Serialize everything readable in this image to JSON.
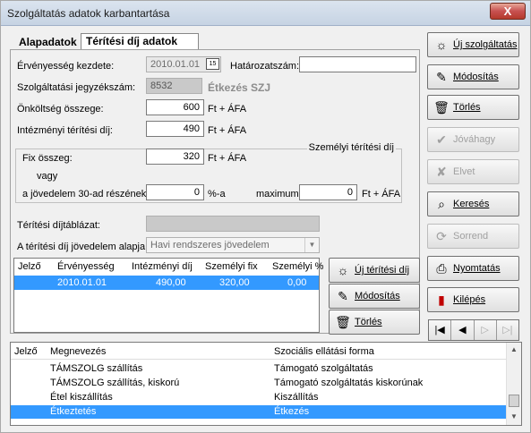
{
  "window": {
    "title": "Szolgáltatás adatok karbantartása",
    "close_label": "X"
  },
  "tabs": [
    "Alapadatok",
    "Térítési díj adatok"
  ],
  "form": {
    "ervenyesseg_label": "Érvényesség kezdete:",
    "ervenyesseg_value": "2010.01.01",
    "calendar_glyph": "15",
    "hatarozat_label": "Határozatszám:",
    "hatarozat_value": "",
    "jegyzekszam_label": "Szolgáltatási jegyzékszám:",
    "jegyzekszam_value": "8532",
    "jegyzekszam_name": "Étkezés SZJ",
    "onkoltseg_label": "Önköltség összege:",
    "onkoltseg_value": "600",
    "onkoltseg_unit": "Ft + ÁFA",
    "intezmenyi_label": "Intézményi térítési díj:",
    "intezmenyi_value": "490",
    "intezmenyi_unit": "Ft + ÁFA",
    "group_title": "Személyi térítési díj",
    "fix_label": "Fix összeg:",
    "fix_value": "320",
    "fix_unit": "Ft + ÁFA",
    "vagy_label": "vagy",
    "jovedelem_label": "a jövedelem 30-ad részének:",
    "jovedelem_value": "0",
    "jovedelem_unit": "%-a",
    "maximum_label": "maximum:",
    "maximum_value": "0",
    "maximum_unit": "Ft + ÁFA",
    "dijtablazat_label": "Térítési díjtáblázat:",
    "dijtablazat_value": "",
    "alap_label": "A térítési díj jövedelem alapja:",
    "alap_value": "Havi rendszeres jövedelem"
  },
  "fee_grid": {
    "columns": [
      "Jelző",
      "Érvényesség",
      "Intézményi díj",
      "Személyi fix",
      "Személyi %"
    ],
    "rows": [
      {
        "jelzo": "",
        "ervenyesseg": "2010.01.01",
        "intezmenyi": "490,00",
        "szemelyi_fix": "320,00",
        "szemelyi_pct": "0,00"
      }
    ]
  },
  "fee_buttons": {
    "new": "Új térítési díj",
    "modify": "Módosítás",
    "delete": "Törlés"
  },
  "side_buttons": {
    "new_service": "Új szolgáltatás",
    "modify": "Módosítás",
    "delete": "Törlés",
    "approve": "Jóváhagy",
    "discard": "Elvet",
    "search": "Keresés",
    "order": "Sorrend",
    "print": "Nyomtatás",
    "exit": "Kilépés"
  },
  "nav": [
    "|◀",
    "◀",
    "▷",
    "▷|"
  ],
  "list_grid": {
    "columns": [
      "Jelző",
      "Megnevezés",
      "Szociális ellátási forma"
    ],
    "rows": [
      {
        "jelzo": "",
        "nev": "TÁMSZOLG szállítás",
        "forma": "Támogató szolgáltatás"
      },
      {
        "jelzo": "",
        "nev": "TÁMSZOLG szállítás, kiskorú",
        "forma": "Támogató szolgáltatás kiskorúnak"
      },
      {
        "jelzo": "",
        "nev": "Étel kiszállítás",
        "forma": "Kiszállítás"
      },
      {
        "jelzo": "",
        "nev": "Étkeztetés",
        "forma": "Étkezés"
      }
    ]
  },
  "colors": {
    "selection": "#3399ff",
    "close_button": "#c75050"
  },
  "icons": {
    "new_service": "sun-doc-icon",
    "modify": "edit-doc-icon",
    "delete": "trash-icon",
    "approve": "checkmark-icon",
    "discard": "x-mark-icon",
    "search": "search-card-icon",
    "order": "refresh-icon",
    "print": "printer-icon",
    "exit": "exit-door-icon"
  }
}
